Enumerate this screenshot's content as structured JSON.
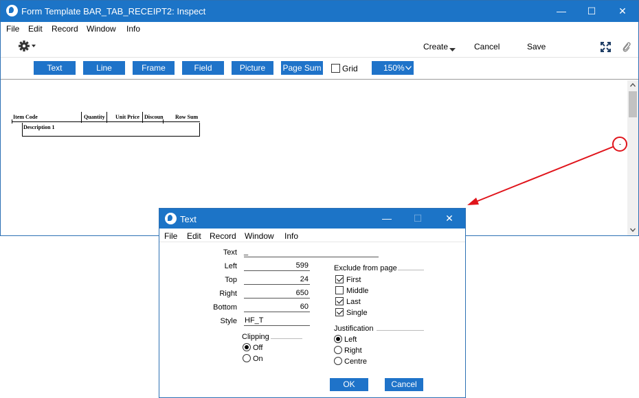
{
  "main_window": {
    "title": "Form Template BAR_TAB_RECEIPT2: Inspect",
    "minimize": "—",
    "maximize": "☐",
    "close": "✕",
    "menu": [
      "File",
      "Edit",
      "Record",
      "Window",
      "Info"
    ],
    "toolbar": {
      "create_label": "Create",
      "cancel_label": "Cancel",
      "save_label": "Save"
    },
    "palette": {
      "buttons": [
        "Text",
        "Line",
        "Frame",
        "Field",
        "Picture",
        "Page Sum"
      ],
      "grid_label": "Grid",
      "grid_checked": false,
      "zoom_value": "150%"
    },
    "form_preview": {
      "columns": [
        "Item Code",
        "Quantity",
        "Unit Price",
        "Discoun",
        "Row Sum"
      ],
      "row_label": "Description 1",
      "selected_marker": "-"
    }
  },
  "dialog": {
    "title": "Text",
    "menu": [
      "File",
      "Edit",
      "Record",
      "Window",
      "Info"
    ],
    "fields": {
      "text_label": "Text",
      "text_value": "_",
      "left_label": "Left",
      "left_value": "599",
      "top_label": "Top",
      "top_value": "24",
      "right_label": "Right",
      "right_value": "650",
      "bottom_label": "Bottom",
      "bottom_value": "60",
      "style_label": "Style",
      "style_value": "HF_T"
    },
    "clipping": {
      "title": "Clipping",
      "options": [
        "Off",
        "On"
      ],
      "selected": "Off"
    },
    "exclude": {
      "title": "Exclude from page",
      "options": [
        {
          "label": "First",
          "checked": true
        },
        {
          "label": "Middle",
          "checked": false
        },
        {
          "label": "Last",
          "checked": true
        },
        {
          "label": "Single",
          "checked": true
        }
      ]
    },
    "justification": {
      "title": "Justification",
      "options": [
        "Left",
        "Right",
        "Centre"
      ],
      "selected": "Left"
    },
    "ok_label": "OK",
    "cancel_label": "Cancel"
  },
  "colors": {
    "titlebar": "#1c74c7",
    "button": "#1f73c9",
    "annotation": "#e0141b"
  }
}
